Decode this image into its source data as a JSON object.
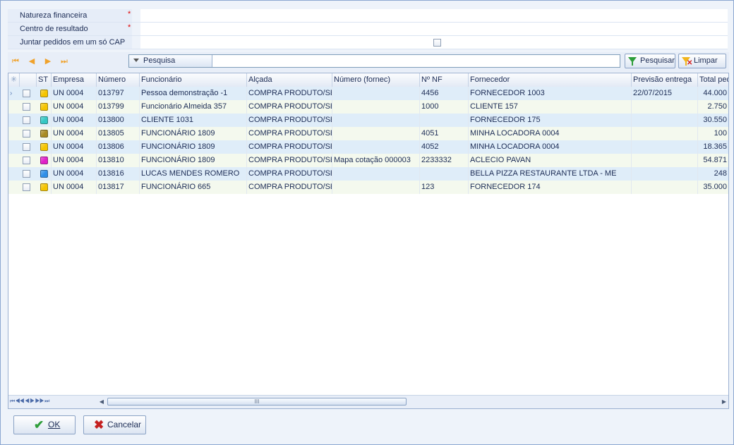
{
  "form": {
    "natureza_label": "Natureza financeira",
    "centro_label": "Centro de resultado",
    "juntar_label": "Juntar pedidos em um só CAP",
    "required_mark": "*"
  },
  "toolbar": {
    "search_label": "Pesquisa",
    "search_value": "",
    "pesquisar_label": "Pesquisar",
    "limpar_label": "Limpar"
  },
  "grid": {
    "headers": {
      "st": "ST",
      "empresa": "Empresa",
      "numero": "Número",
      "funcionario": "Funcionário",
      "alcada": "Alçada",
      "numero_fornec": "Número (fornec)",
      "nf": "Nº NF",
      "fornecedor": "Fornecedor",
      "previsao": "Previsão entrega",
      "total": "Total ped"
    },
    "rows": [
      {
        "status_color": "#f5c400",
        "empresa": "UN 0004",
        "numero": "013797",
        "funcionario": "Pessoa demonstração -1",
        "alcada": "COMPRA PRODUTO/SER",
        "numero_fornec": "",
        "nf": "4456",
        "fornecedor": "FORNECEDOR  1003",
        "previsao": "22/07/2015",
        "total": "44.000"
      },
      {
        "status_color": "#f5c400",
        "empresa": "UN 0004",
        "numero": "013799",
        "funcionario": "Funcionário Almeida 357",
        "alcada": "COMPRA PRODUTO/SER",
        "numero_fornec": "",
        "nf": "1000",
        "fornecedor": "CLIENTE  157",
        "previsao": "",
        "total": "2.750"
      },
      {
        "status_color": "#33c7c4",
        "empresa": "UN 0004",
        "numero": "013800",
        "funcionario": "CLIENTE  1031",
        "alcada": "COMPRA PRODUTO/SER",
        "numero_fornec": "",
        "nf": "",
        "fornecedor": "FORNECEDOR  175",
        "previsao": "",
        "total": "30.550"
      },
      {
        "status_color": "#a88a22",
        "empresa": "UN 0004",
        "numero": "013805",
        "funcionario": "FUNCIONÁRIO  1809",
        "alcada": "COMPRA PRODUTO/SER",
        "numero_fornec": "",
        "nf": "4051",
        "fornecedor": "MINHA LOCADORA 0004",
        "previsao": "",
        "total": "100"
      },
      {
        "status_color": "#f5c400",
        "empresa": "UN 0004",
        "numero": "013806",
        "funcionario": "FUNCIONÁRIO  1809",
        "alcada": "COMPRA PRODUTO/SER",
        "numero_fornec": "",
        "nf": "4052",
        "fornecedor": "MINHA LOCADORA 0004",
        "previsao": "",
        "total": "18.365"
      },
      {
        "status_color": "#e020c8",
        "empresa": "UN 0004",
        "numero": "013810",
        "funcionario": "FUNCIONÁRIO  1809",
        "alcada": "COMPRA PRODUTO/SER",
        "numero_fornec": "Mapa cotação 000003",
        "nf": "2233332",
        "fornecedor": "ACLECIO PAVAN",
        "previsao": "",
        "total": "54.871"
      },
      {
        "status_color": "#2f8fe8",
        "empresa": "UN 0004",
        "numero": "013816",
        "funcionario": "LUCAS MENDES ROMERO",
        "alcada": "COMPRA PRODUTO/SER",
        "numero_fornec": "",
        "nf": "",
        "fornecedor": "BELLA PIZZA RESTAURANTE LTDA - ME",
        "previsao": "",
        "total": "248"
      },
      {
        "status_color": "#f5c400",
        "empresa": "UN 0004",
        "numero": "013817",
        "funcionario": "FUNCIONÁRIO  665",
        "alcada": "COMPRA PRODUTO/SER",
        "numero_fornec": "",
        "nf": "123",
        "fornecedor": "FORNECEDOR  174",
        "previsao": "",
        "total": "35.000"
      }
    ],
    "scroll_thumb_label": "III"
  },
  "buttons": {
    "ok_label": "OK",
    "cancel_label": "Cancelar"
  }
}
